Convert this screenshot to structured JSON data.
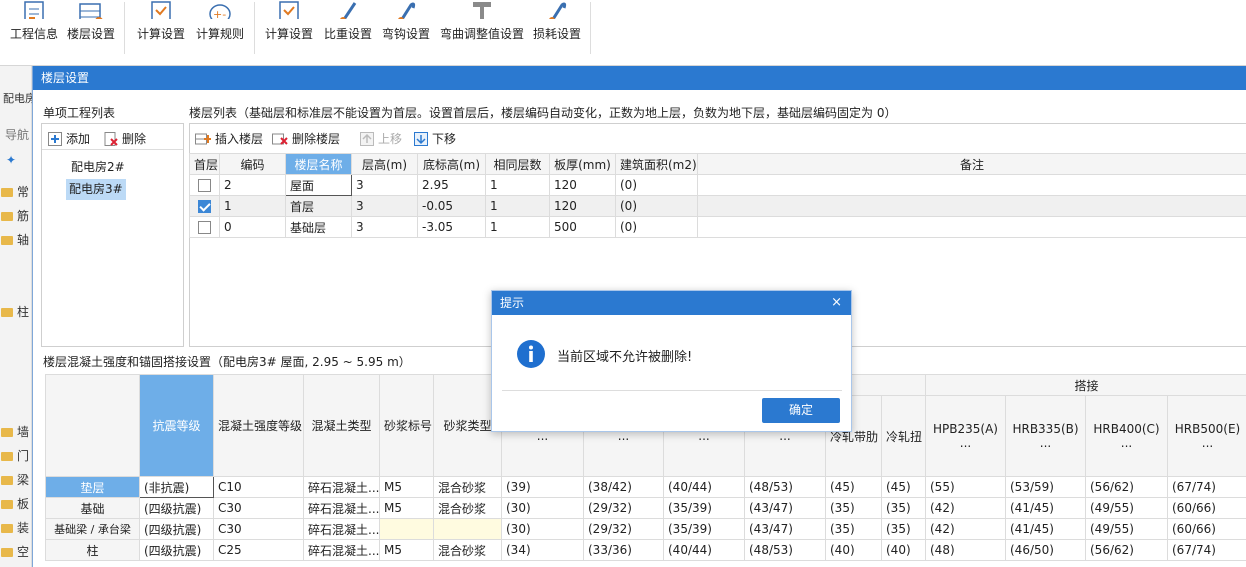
{
  "ribbon": [
    {
      "label": "工程信息",
      "icon": "project-info-icon"
    },
    {
      "label": "楼层设置",
      "icon": "floor-settings-icon"
    },
    {
      "label": "计算设置",
      "icon": "calc-settings-icon"
    },
    {
      "label": "计算规则",
      "icon": "calc-rules-icon"
    },
    {
      "label": "计算设置",
      "icon": "calc-settings2-icon"
    },
    {
      "label": "比重设置",
      "icon": "density-icon"
    },
    {
      "label": "弯钩设置",
      "icon": "hook-icon"
    },
    {
      "label": "弯曲调整值设置",
      "icon": "bend-adjust-icon"
    },
    {
      "label": "损耗设置",
      "icon": "loss-icon"
    }
  ],
  "leftstrip": {
    "tab": "配电房",
    "nav": "导航",
    "items": [
      "常",
      "筋",
      "轴",
      "柱",
      "墙",
      "门",
      "梁",
      "板",
      "装",
      "空"
    ]
  },
  "dialog": {
    "title": "楼层设置",
    "project_list_label": "单项工程列表",
    "add_label": "添加",
    "delete_label": "删除",
    "projects": [
      "配电房2#",
      "配电房3#"
    ],
    "floor_list_label": "楼层列表（基础层和标准层不能设置为首层。设置首层后，楼层编码自动变化，正数为地上层，负数为地下层，基础层编码固定为 0）",
    "insert_floor": "插入楼层",
    "delete_floor": "删除楼层",
    "move_up": "上移",
    "move_down": "下移",
    "floor_headers": [
      "首层",
      "编码",
      "楼层名称",
      "层高(m)",
      "底标高(m)",
      "相同层数",
      "板厚(mm)",
      "建筑面积(m2)",
      "备注"
    ],
    "floors": [
      {
        "code": "2",
        "name": "屋面",
        "height": "3",
        "bottom": "2.95",
        "same": "1",
        "thick": "120",
        "area": "(0)",
        "note": ""
      },
      {
        "code": "1",
        "name": "首层",
        "height": "3",
        "bottom": "-0.05",
        "same": "1",
        "thick": "120",
        "area": "(0)",
        "note": ""
      },
      {
        "code": "0",
        "name": "基础层",
        "height": "3",
        "bottom": "-3.05",
        "same": "1",
        "thick": "500",
        "area": "(0)",
        "note": ""
      }
    ],
    "concrete_label": "楼层混凝土强度和锚固搭接设置（配电房3#  屋面, 2.95 ~ 5.95 m）",
    "lap_header": "搭接",
    "concrete_headers": [
      "抗震等级",
      "混凝土强度等级",
      "混凝土类型",
      "砂浆标号",
      "砂浆类型",
      "...",
      "...",
      "...",
      "...",
      "冷轧带肋",
      "冷轧扭",
      "HPB235(A)",
      "HRB335(B)",
      "HRB400(C)",
      "HRB500(E)"
    ],
    "ellipsis": "...",
    "concrete_rows": [
      {
        "name": "垫层",
        "cells": [
          "(非抗震)",
          "C10",
          "碎石混凝土...",
          "M5",
          "混合砂浆",
          "(39)",
          "(38/42)",
          "(40/44)",
          "(48/53)",
          "(45)",
          "(45)",
          "(55)",
          "(53/59)",
          "(56/62)",
          "(67/74)"
        ]
      },
      {
        "name": "基础",
        "cells": [
          "(四级抗震)",
          "C30",
          "碎石混凝土...",
          "M5",
          "混合砂浆",
          "(30)",
          "(29/32)",
          "(35/39)",
          "(43/47)",
          "(35)",
          "(35)",
          "(42)",
          "(41/45)",
          "(49/55)",
          "(60/66)"
        ]
      },
      {
        "name": "基础梁 / 承台梁",
        "cells": [
          "(四级抗震)",
          "C30",
          "碎石混凝土...",
          "",
          "",
          "(30)",
          "(29/32)",
          "(35/39)",
          "(43/47)",
          "(35)",
          "(35)",
          "(42)",
          "(41/45)",
          "(49/55)",
          "(60/66)"
        ]
      },
      {
        "name": "柱",
        "cells": [
          "(四级抗震)",
          "C25",
          "碎石混凝土...",
          "M5",
          "混合砂浆",
          "(34)",
          "(33/36)",
          "(40/44)",
          "(48/53)",
          "(40)",
          "(40)",
          "(48)",
          "(46/50)",
          "(56/62)",
          "(67/74)"
        ]
      }
    ]
  },
  "modal": {
    "title": "提示",
    "close": "×",
    "message": "当前区域不允许被删除!",
    "ok": "确定"
  }
}
